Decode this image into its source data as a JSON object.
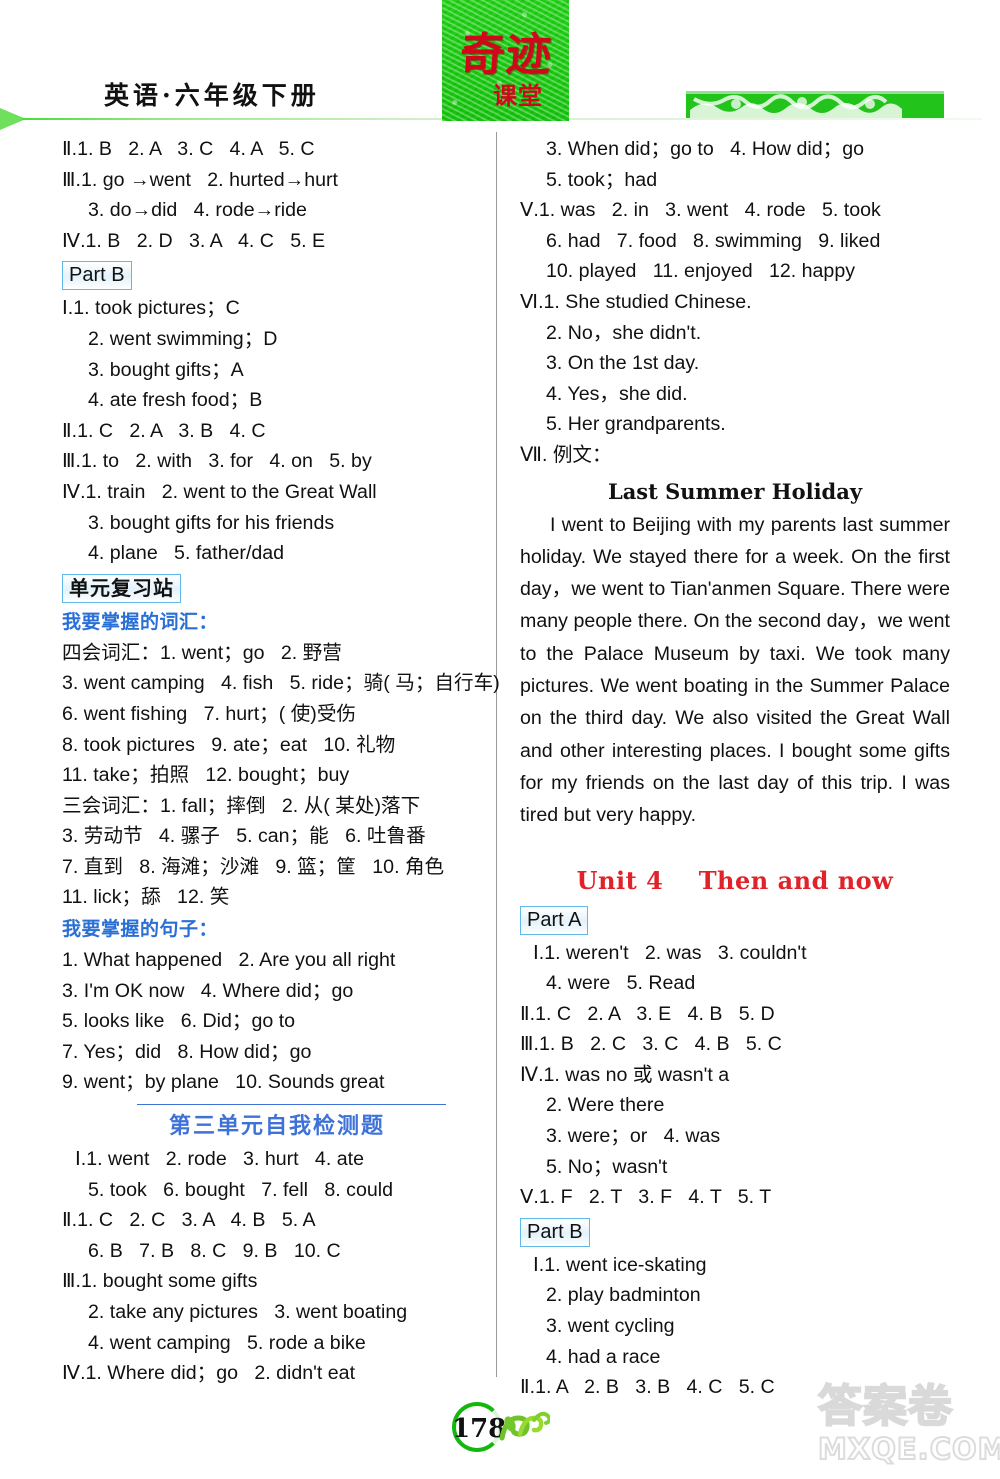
{
  "header": {
    "book_title": "英语·六年级下册",
    "logo_main": "奇迹",
    "logo_sub": "课堂"
  },
  "left_column": {
    "unit3_partA_tail": [
      "Ⅱ.1. B   2. A   3. C   4. A   5. C",
      "Ⅲ.1. go →went   2. hurted→hurt",
      "3. do→did   4. rode→ride",
      "Ⅳ.1. B   2. D   3. A   4. C   5. E"
    ],
    "part_b_label": "Part B",
    "part_b_answers": [
      "Ⅰ.1. took pictures；C",
      "2. went swimming；D",
      "3. bought gifts；A",
      "4. ate fresh food；B",
      "Ⅱ.1. C   2. A   3. B   4. C",
      "Ⅲ.1. to   2. with   3. for   4. on   5. by",
      "Ⅳ.1. train   2. went to the Great Wall",
      "3. bought gifts for his friends",
      "4. plane   5. father/dad"
    ],
    "review_label": "单元复习站",
    "vocab_heading": "我要掌握的词汇：",
    "vocab_lines": [
      "四会词汇：1. went；go   2. 野营",
      "3. went camping   4. fish   5. ride；骑( 马；自行车)",
      "6. went fishing   7. hurt；( 使)受伤",
      "8. took pictures   9. ate；eat   10. 礼物",
      "11. take；拍照   12. bought；buy",
      "三会词汇：1. fall；摔倒   2. 从( 某处)落下",
      "3. 劳动节   4. 骡子   5. can；能   6. 吐鲁番",
      "7. 直到   8. 海滩；沙滩   9. 篮；筐   10. 角色",
      "11. lick；舔   12. 笑"
    ],
    "sentence_heading": "我要掌握的句子：",
    "sentence_lines": [
      "1. What happened   2. Are you all right",
      "3. I'm OK now   4. Where did；go",
      "5. looks like   6. Did；go to",
      "7. Yes；did   8. How did；go",
      "9. went；by plane   10. Sounds great"
    ],
    "self_test_title": "第三单元自我检测题",
    "self_test_answers": [
      "Ⅰ.1. went   2. rode   3. hurt   4. ate",
      "5. took   6. bought   7. fell   8. could",
      "Ⅱ.1. C   2. C   3. A   4. B   5. A",
      "6. B   7. B   8. C   9. B   10. C",
      "Ⅲ.1. bought some gifts",
      "2. take any pictures   3. went boating",
      "4. went camping   5. rode a bike",
      "Ⅳ.1. Where did；go   2. didn't eat"
    ]
  },
  "right_column": {
    "continued_answers": [
      "3. When did；go to   4. How did；go",
      "5. took；had",
      "Ⅴ.1. was   2. in   3. went   4. rode   5. took",
      "6. had   7. food   8. swimming   9. liked",
      "10. played   11. enjoyed   12. happy",
      "Ⅵ.1. She studied Chinese.",
      "2. No，she didn't.",
      "3. On the 1st day.",
      "4. Yes，she did.",
      "5. Her grandparents.",
      "Ⅶ. 例文："
    ],
    "essay_title": "Last Summer Holiday",
    "essay_body": "I went to Beijing with my parents last summer holiday. We stayed there for a week. On the first day，we went to Tian'anmen Square. There were many people there. On the second day，we went to the Palace Museum by taxi. We took many pictures. We went boating in the Summer Palace on the third day. We also visited the Great Wall and other interesting places. I bought some gifts for my friends on the last day of this trip. I was tired but very happy.",
    "unit_heading": "Unit 4    Then and now",
    "part_a_label": "Part A",
    "part_a_answers": [
      "Ⅰ.1. weren't   2. was   3. couldn't",
      "4. were   5. Read",
      "Ⅱ.1. C   2. A   3. E   4. B   5. D",
      "Ⅲ.1. B   2. C   3. C   4. B   5. C",
      "Ⅳ.1. was no 或 wasn't a",
      "2. Were there",
      "3. were；or   4. was",
      "5. No；wasn't",
      "Ⅴ.1. F   2. T   3. F   4. T   5. T"
    ],
    "part_b_label": "Part B",
    "part_b_answers": [
      "Ⅰ.1. went ice-skating",
      "2. play badminton",
      "3. went cycling",
      "4. had a race",
      "Ⅱ.1. A   2. B   3. B   4. C   5. C"
    ]
  },
  "footer": {
    "page_number": "178",
    "watermark_cn": "答案卷",
    "watermark_en": "MXQE.COM"
  },
  "colors": {
    "logo_green": "#14c40c",
    "logo_red": "#d1081b",
    "unit_red": "#e0232a",
    "heading_blue": "#2a6fd6",
    "box_border_blue": "#5fb8e8"
  }
}
